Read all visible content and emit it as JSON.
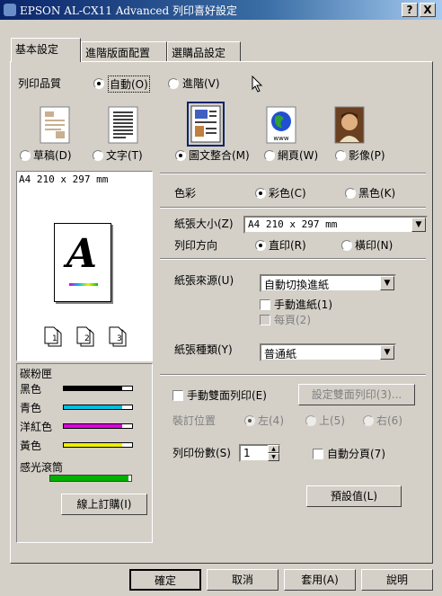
{
  "window": {
    "title": "EPSON AL-CX11 Advanced 列印喜好設定",
    "help_btn": "?",
    "close_btn": "X"
  },
  "tabs": [
    "基本設定",
    "進階版面配置",
    "選購品設定"
  ],
  "quality": {
    "label": "列印品質",
    "auto": "自動(O)",
    "advanced": "進階(V)",
    "modes": [
      "草稿(D)",
      "文字(T)",
      "圖文整合(M)",
      "網頁(W)",
      "影像(P)"
    ],
    "mode_icons": [
      "draft-page-icon",
      "text-page-icon",
      "text-image-page-icon",
      "globe-www-icon",
      "photo-portrait-icon"
    ]
  },
  "preview": {
    "paper_label": "A4 210 x 297 mm",
    "glyph": "A",
    "pages": [
      "1",
      "2",
      "3"
    ]
  },
  "toner": {
    "title": "碳粉匣",
    "items": [
      {
        "label": "黑色",
        "color": "#000000",
        "level": 0.85
      },
      {
        "label": "青色",
        "color": "#00c0e0",
        "level": 0.85
      },
      {
        "label": "洋紅色",
        "color": "#e000e0",
        "level": 0.85
      },
      {
        "label": "黃色",
        "color": "#f0f000",
        "level": 0.85
      }
    ],
    "drum_label": "感光滾筒",
    "drum_color": "#00b000",
    "drum_level": 0.97,
    "order_btn": "線上訂購(I)"
  },
  "color": {
    "label": "色彩",
    "opt_color": "彩色(C)",
    "opt_bw": "黑色(K)"
  },
  "paper_size": {
    "label": "紙張大小(Z)",
    "value": "A4 210 x 297 mm"
  },
  "orientation": {
    "label": "列印方向",
    "portrait": "直印(R)",
    "landscape": "橫印(N)"
  },
  "paper_source": {
    "label": "紙張來源(U)",
    "value": "自動切換進紙",
    "manual_feed": "手動進紙(1)",
    "each_page": "每頁(2)"
  },
  "paper_type": {
    "label": "紙張種類(Y)",
    "value": "普通紙"
  },
  "duplex": {
    "manual_label": "手動雙面列印(E)",
    "settings_btn": "設定雙面列印(3)...",
    "binding_label": "裝訂位置",
    "left": "左(4)",
    "top": "上(5)",
    "right": "右(6)"
  },
  "copies": {
    "label": "列印份數(S)",
    "value": "1",
    "collate": "自動分頁(7)"
  },
  "defaults_btn": "預設值(L)",
  "footer": {
    "ok": "確定",
    "cancel": "取消",
    "apply": "套用(A)",
    "help": "說明"
  }
}
